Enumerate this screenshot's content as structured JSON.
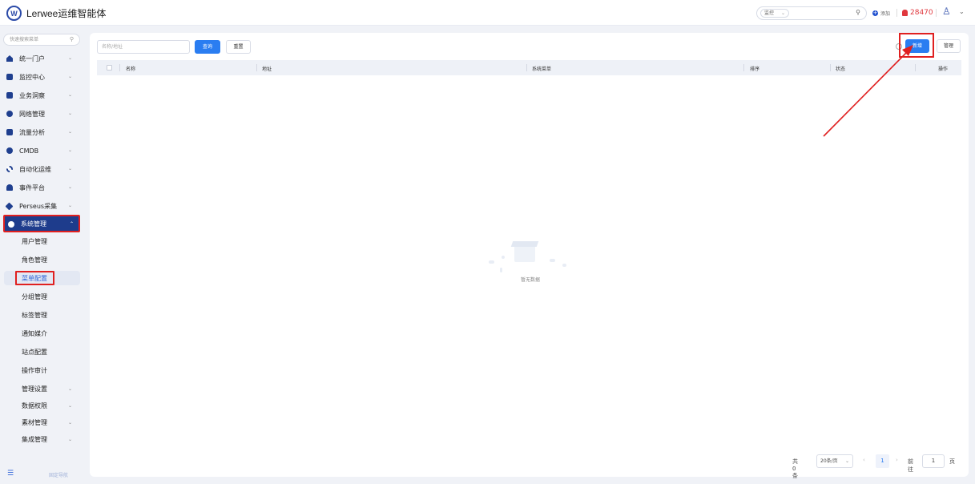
{
  "header": {
    "logo_text": "W",
    "app_title": "Lerwee运维智能体",
    "search_scope": "监控",
    "add_label": "添加",
    "alert_count": "28470"
  },
  "sidebar": {
    "search_placeholder": "快速搜索菜单",
    "items": [
      {
        "label": "统一门户"
      },
      {
        "label": "监控中心"
      },
      {
        "label": "业务洞察"
      },
      {
        "label": "网络管理"
      },
      {
        "label": "流量分析"
      },
      {
        "label": "CMDB"
      },
      {
        "label": "自动化运维"
      },
      {
        "label": "事件平台"
      },
      {
        "label": "Perseus采集"
      },
      {
        "label": "系统管理"
      }
    ],
    "sub_items": [
      {
        "label": "用户管理"
      },
      {
        "label": "角色管理"
      },
      {
        "label": "菜单配置"
      },
      {
        "label": "分组管理"
      },
      {
        "label": "标签管理"
      },
      {
        "label": "通知媒介"
      },
      {
        "label": "站点配置"
      },
      {
        "label": "操作审计"
      },
      {
        "label": "管理设置"
      },
      {
        "label": "数据权限"
      },
      {
        "label": "素材管理"
      },
      {
        "label": "集成管理"
      }
    ],
    "footer_label": "固定导航"
  },
  "toolbar": {
    "filter_placeholder": "名称/地址",
    "query_label": "查询",
    "reset_label": "重置",
    "new_label": "新增",
    "manage_label": "管理"
  },
  "table": {
    "columns": [
      "名称",
      "地址",
      "系统菜单",
      "排序",
      "状态",
      "操作"
    ],
    "rows": [],
    "empty_text": "暂无数据"
  },
  "pagination": {
    "total_text": "共 0 条",
    "page_size": "20条/页",
    "current_page": "1",
    "goto_label": "前往",
    "goto_value": "1",
    "page_unit": "页"
  },
  "colors": {
    "primary": "#2a7df1",
    "nav_active": "#1e3c8c",
    "highlight": "#e02020",
    "alert": "#e0383e"
  }
}
